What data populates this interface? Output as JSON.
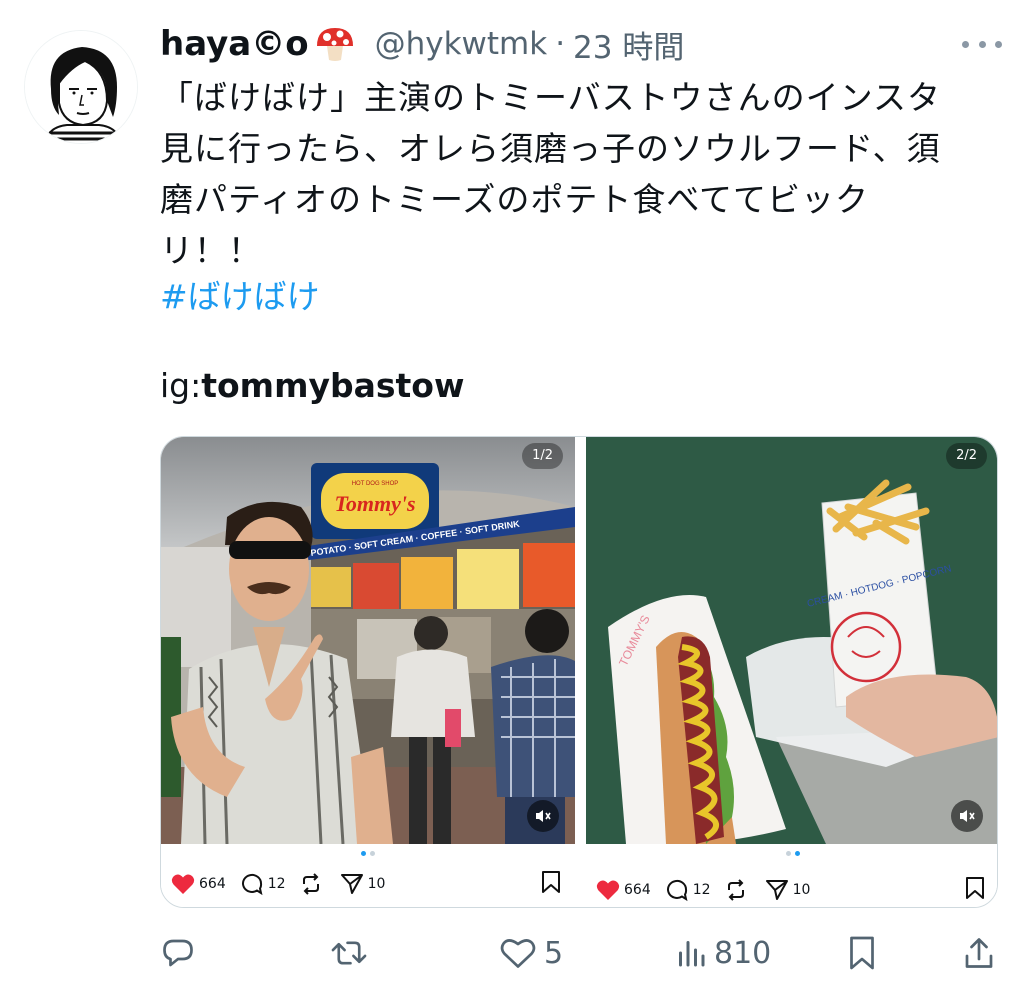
{
  "author": {
    "display_name": "haya©o",
    "handle": "@hykwtmk",
    "separator": "·",
    "time": "23 時間",
    "name_emoji_icon": "mushroom-icon"
  },
  "tweet": {
    "lines": [
      "「ばけばけ」主演のトミーバストウさんのインスタ",
      "見に行ったら、オレら須磨っ子のソウルフード、須",
      "磨パティオのトミーズのポテト食べててビック",
      "リ！！"
    ],
    "hashtag": "#ばけばけ",
    "ig_prefix": "ig:",
    "ig_handle": "tommybastow"
  },
  "media": {
    "panels": [
      {
        "counter": "1/2",
        "likes": "664",
        "comments": "12",
        "shares": "10",
        "sign": {
          "brand": "Tommy's",
          "small": "HOT DOG SHOP",
          "menu": "POTATO · SOFT CREAM · COFFEE · SOFT DRINK"
        }
      },
      {
        "counter": "2/2",
        "likes": "664",
        "comments": "12",
        "shares": "10",
        "bag_text": "CREAM · HOTDOG · POPCORN"
      }
    ]
  },
  "actions": {
    "reply_count": "",
    "retweet_count": "",
    "like_count": "5",
    "views_count": "810"
  },
  "colors": {
    "link": "#1d9bf0",
    "secondary": "#536471",
    "heart": "#f91880",
    "mustard": "#e8c62a"
  }
}
